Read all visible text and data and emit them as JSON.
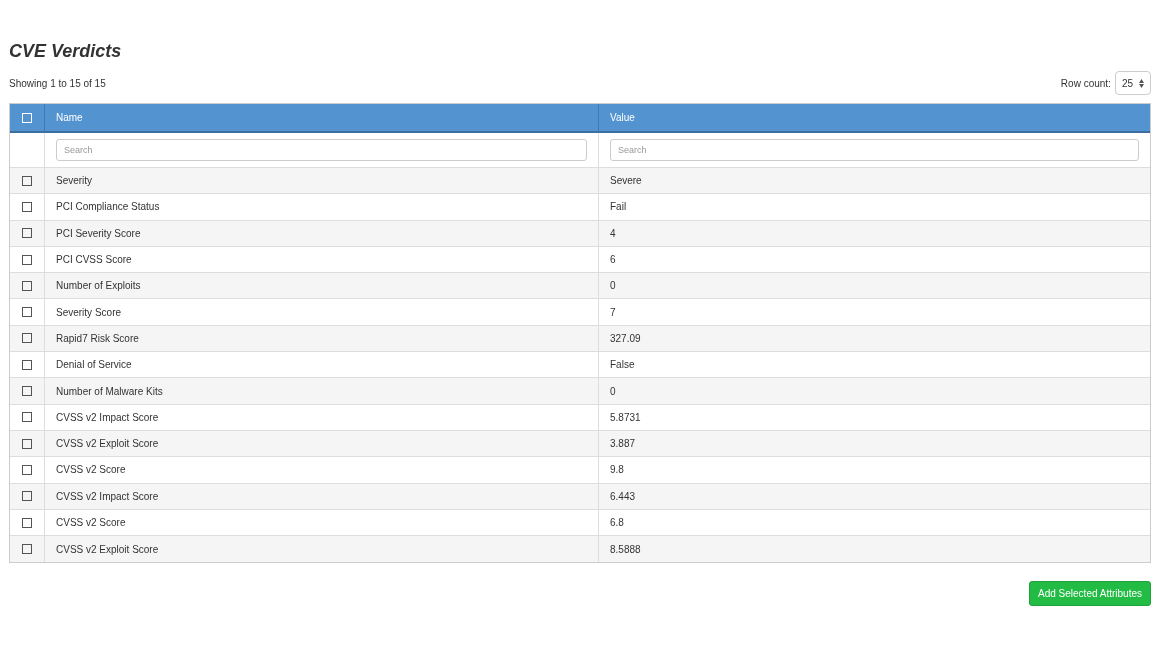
{
  "title": "CVE Verdicts",
  "summary": "Showing 1 to 15 of 15",
  "row_count": {
    "label": "Row count:",
    "value": "25"
  },
  "table": {
    "select_all": {
      "checked": false
    },
    "columns": [
      {
        "label": "Name",
        "placeholder": "Search"
      },
      {
        "label": "Value",
        "placeholder": "Search"
      }
    ],
    "rows": [
      {
        "name": "Severity",
        "value": "Severe",
        "checked": false
      },
      {
        "name": "PCI Compliance Status",
        "value": "Fail",
        "checked": false
      },
      {
        "name": "PCI Severity Score",
        "value": "4",
        "checked": false
      },
      {
        "name": "PCI CVSS Score",
        "value": "6",
        "checked": false
      },
      {
        "name": "Number of Exploits",
        "value": "0",
        "checked": false
      },
      {
        "name": "Severity Score",
        "value": "7",
        "checked": false
      },
      {
        "name": "Rapid7 Risk Score",
        "value": "327.09",
        "checked": false
      },
      {
        "name": "Denial of Service",
        "value": "False",
        "checked": false
      },
      {
        "name": "Number of Malware Kits",
        "value": "0",
        "checked": false
      },
      {
        "name": "CVSS v2 Impact Score",
        "value": "5.8731",
        "checked": false
      },
      {
        "name": "CVSS v2 Exploit Score",
        "value": "3.887",
        "checked": false
      },
      {
        "name": "CVSS v2 Score",
        "value": "9.8",
        "checked": false
      },
      {
        "name": "CVSS v2 Impact Score",
        "value": "6.443",
        "checked": false
      },
      {
        "name": "CVSS v2 Score",
        "value": "6.8",
        "checked": false
      },
      {
        "name": "CVSS v2 Exploit Score",
        "value": "8.5888",
        "checked": false
      }
    ]
  },
  "action_button": "Add Selected Attributes"
}
